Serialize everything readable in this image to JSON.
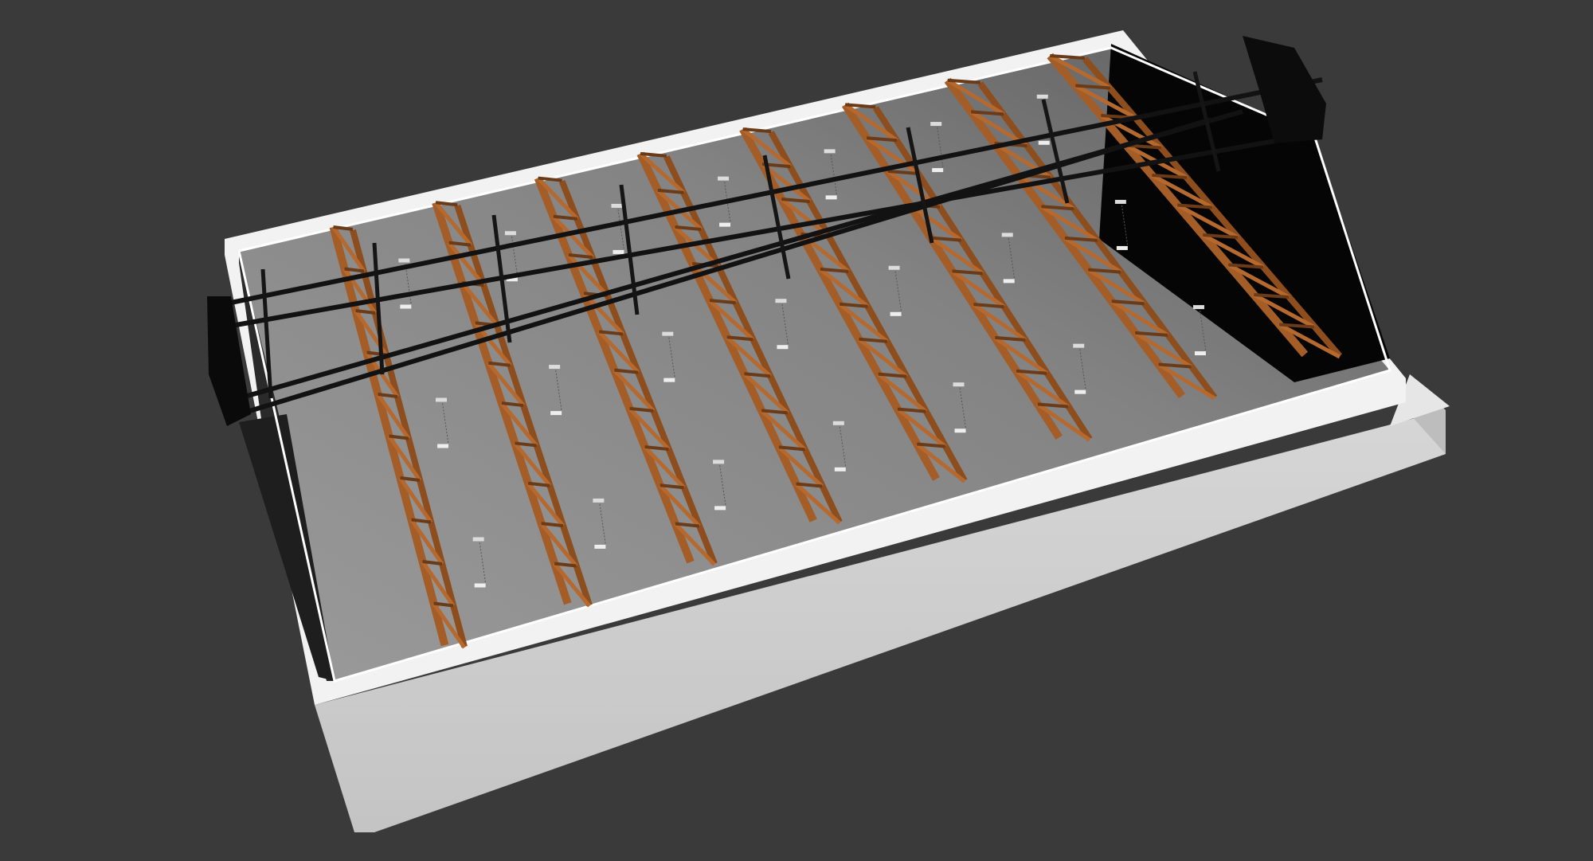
{
  "viewport": {
    "background": "#3a3a3a"
  },
  "model": {
    "truss_count": 8,
    "colors": {
      "wall_top": "#f0f0f0",
      "wall_side": "#d8d8d8",
      "outer_face": "#cfcfcf",
      "floor": "#8a8a8a",
      "floor_far": "#6f6f6f",
      "dark_end": "#000000",
      "truss_wood": "#a85f2a",
      "truss_wood_dark": "#6b3a16",
      "skylight_frame": "#1a1a1a",
      "fixture": "#e8e8e8"
    }
  }
}
